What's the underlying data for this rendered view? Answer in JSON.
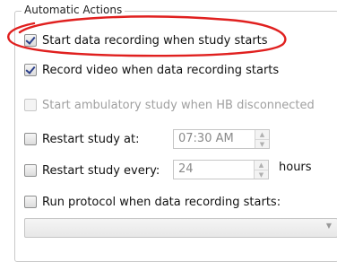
{
  "group": {
    "title": "Automatic Actions"
  },
  "options": [
    {
      "label": "Start data recording when study starts",
      "checked": true,
      "enabled": true
    },
    {
      "label": "Record video when data recording starts",
      "checked": true,
      "enabled": true
    },
    {
      "label": "Start ambulatory study when HB disconnected",
      "checked": false,
      "enabled": false
    },
    {
      "label": "Restart study at:",
      "checked": false,
      "enabled": true
    },
    {
      "label": "Restart study every:",
      "checked": false,
      "enabled": true
    },
    {
      "label": "Run protocol when data recording starts:",
      "checked": false,
      "enabled": true
    }
  ],
  "restart_at": {
    "value": "07:30 AM"
  },
  "restart_every": {
    "value": "24",
    "unit": "hours"
  },
  "protocol_select": {
    "value": ""
  },
  "annotation": {
    "color": "#e0201f"
  }
}
